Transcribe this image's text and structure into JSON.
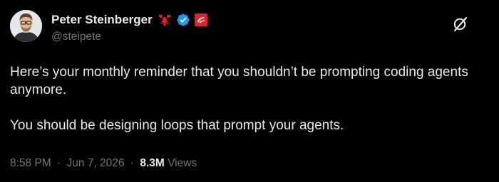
{
  "author": {
    "display_name": "Peter Steinberger",
    "handle": "@steipete",
    "emoji_icon": "lobster-icon",
    "verified_icon": "verified-badge-icon",
    "affiliate_icon": "red-badge-icon"
  },
  "tweet": {
    "paragraph_1": "Here’s your monthly reminder that you shouldn’t be prompting coding agents anymore.",
    "paragraph_2": "You should be designing loops that prompt your agents."
  },
  "meta": {
    "time": "8:58 PM",
    "separator": "·",
    "date": "Jun 7, 2026",
    "views_count": "8.3M",
    "views_label": "Views"
  },
  "colors": {
    "background": "#000000",
    "text_primary": "#e7e9ea",
    "text_secondary": "#71767b",
    "verified_blue": "#1d9bf0",
    "lobster_red": "#d9272e"
  },
  "icons": {
    "grok": "grok-icon"
  }
}
